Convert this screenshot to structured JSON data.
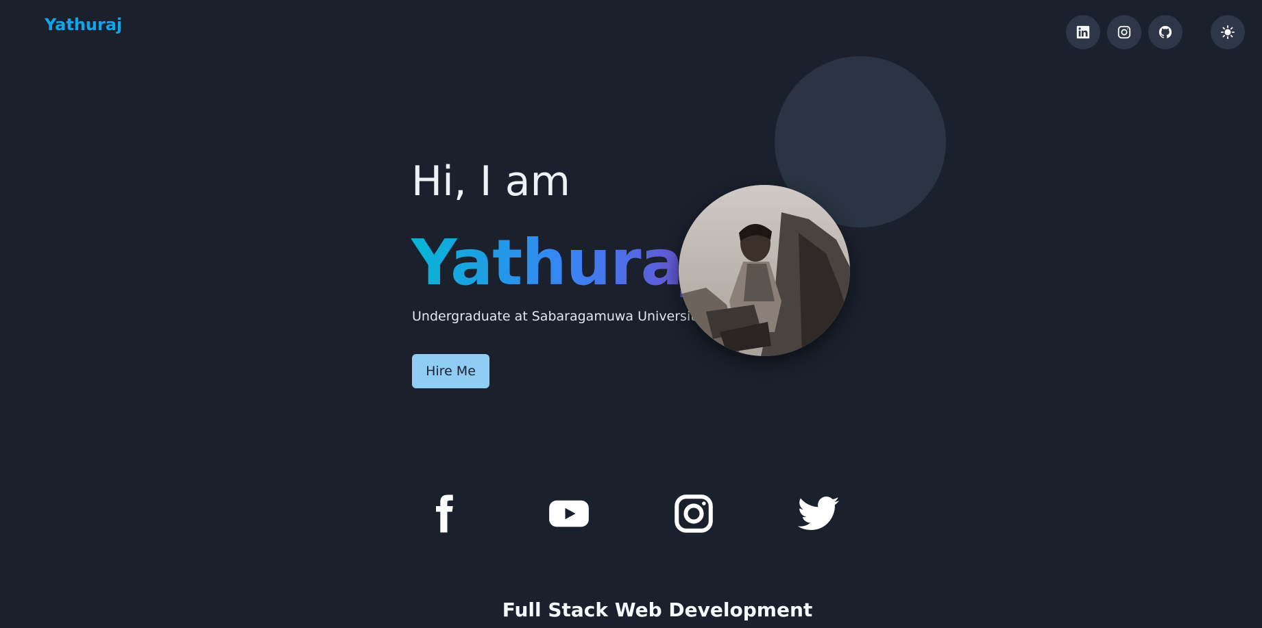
{
  "header": {
    "logo": "Yathuraj",
    "icons": [
      "linkedin-icon",
      "instagram-icon",
      "github-icon"
    ],
    "theme_icon": "sun-icon"
  },
  "hero": {
    "greeting": "Hi, I am",
    "name": "Yathuraj",
    "subtitle": "Undergraduate at Sabaragamuwa University",
    "hire_label": "Hire Me"
  },
  "socials": [
    "facebook-icon",
    "youtube-icon",
    "instagram-icon",
    "twitter-icon"
  ],
  "section": {
    "title": "Full Stack Web Development"
  },
  "colors": {
    "background": "#1a202c",
    "accent": "#0ea5e9",
    "button": "#90cdf4",
    "icon_bg": "#2d3748",
    "gradient": [
      "#06b6d4",
      "#3b82f6",
      "#6d4ec9"
    ]
  }
}
